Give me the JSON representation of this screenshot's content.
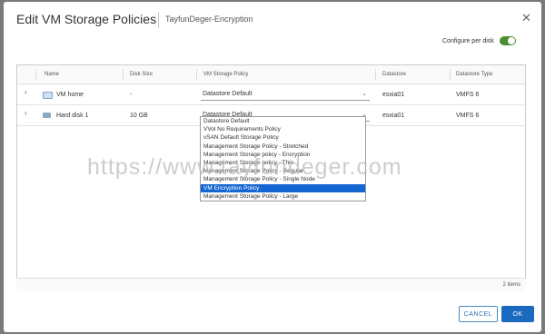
{
  "dialog": {
    "title": "Edit VM Storage Policies",
    "subtitle": "TayfunDeger-Encryption",
    "configure_per_disk_label": "Configure per disk",
    "configure_per_disk_on": true
  },
  "table": {
    "headers": [
      "Name",
      "Disk Size",
      "VM Storage Policy",
      "Datastore",
      "Datastore Type"
    ],
    "rows": [
      {
        "name": "VM home",
        "disk_size": "-",
        "policy": "Datastore Default",
        "datastore": "esxia01",
        "datastore_type": "VMFS 6"
      },
      {
        "name": "Hard disk 1",
        "disk_size": "10 GB",
        "policy": "Datastore Default",
        "datastore": "esxia01",
        "datastore_type": "VMFS 6"
      }
    ],
    "footer_count": "2 items"
  },
  "dropdown": {
    "options": [
      "Datastore Default",
      "VVol No Requirements Policy",
      "vSAN Default Storage Policy",
      "Management Storage Policy - Stretched",
      "Management Storage policy - Encryption",
      "Management Storage policy - Thin",
      "Management Storage Policy - Regular",
      "Management Storage Policy - Single Node",
      "VM Encryption Policy",
      "Management Storage Policy - Large"
    ],
    "highlighted": "VM Encryption Policy"
  },
  "buttons": {
    "cancel": "CANCEL",
    "ok": "OK"
  },
  "watermark": "https://www.tayfundeger.com",
  "colors": {
    "accent": "#1a6bc0",
    "toggle": "#4a8f2f",
    "highlight": "#1466d2"
  }
}
